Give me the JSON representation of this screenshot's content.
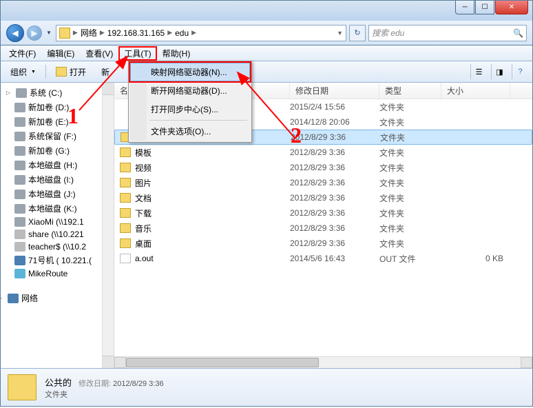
{
  "address": {
    "segs": [
      "网络",
      "192.168.31.165",
      "edu"
    ],
    "refresh_icon": "↻"
  },
  "search": {
    "placeholder": "搜索 edu",
    "icon": "🔍"
  },
  "menubar": [
    "文件(F)",
    "编辑(E)",
    "查看(V)",
    "工具(T)",
    "帮助(H)"
  ],
  "toolbar": {
    "organize": "组织",
    "open": "打开",
    "new": "新"
  },
  "dropdown": {
    "items": [
      "映射网络驱动器(N)...",
      "断开网络驱动器(D)...",
      "打开同步中心(S)...",
      "文件夹选项(O)..."
    ]
  },
  "tree": {
    "items": [
      {
        "label": "系统 (C:)",
        "exp": true
      },
      {
        "label": "新加卷 (D:)"
      },
      {
        "label": "新加卷 (E:)"
      },
      {
        "label": "系统保留 (F:)"
      },
      {
        "label": "新加卷 (G:)"
      },
      {
        "label": "本地磁盘 (H:)"
      },
      {
        "label": "本地磁盘 (I:)"
      },
      {
        "label": "本地磁盘 (J:)"
      },
      {
        "label": "本地磁盘 (K:)"
      },
      {
        "label": "XiaoMi (\\\\192.1"
      },
      {
        "label": "share (\\\\10.221",
        "disabled": true
      },
      {
        "label": "teacher$ (\\\\10.2",
        "disabled": true
      },
      {
        "label": "71号机 ( 10.221.(",
        "icon": "net"
      },
      {
        "label": "MikeRoute",
        "icon": "route"
      }
    ],
    "root": "网络"
  },
  "columns": {
    "name": "名称",
    "date": "修改日期",
    "type": "类型",
    "size": "大小"
  },
  "files": [
    {
      "name": "",
      "date": "2015/2/4 15:56",
      "type": "文件夹",
      "hidden": true
    },
    {
      "name": "",
      "date": "2014/12/8 20:06",
      "type": "文件夹",
      "hidden": true
    },
    {
      "name": "公共的",
      "date": "2012/8/29 3:36",
      "type": "文件夹",
      "sel": true
    },
    {
      "name": "模板",
      "date": "2012/8/29 3:36",
      "type": "文件夹"
    },
    {
      "name": "视频",
      "date": "2012/8/29 3:36",
      "type": "文件夹"
    },
    {
      "name": "图片",
      "date": "2012/8/29 3:36",
      "type": "文件夹"
    },
    {
      "name": "文档",
      "date": "2012/8/29 3:36",
      "type": "文件夹"
    },
    {
      "name": "下载",
      "date": "2012/8/29 3:36",
      "type": "文件夹"
    },
    {
      "name": "音乐",
      "date": "2012/8/29 3:36",
      "type": "文件夹"
    },
    {
      "name": "桌面",
      "date": "2012/8/29 3:36",
      "type": "文件夹"
    },
    {
      "name": "a.out",
      "date": "2014/5/6 16:43",
      "type": "OUT 文件",
      "size": "0 KB",
      "file": true
    }
  ],
  "details": {
    "name": "公共的",
    "date_label": "修改日期:",
    "date": "2012/8/29 3:36",
    "type": "文件夹"
  },
  "anno": {
    "n1": "1",
    "n2": "2"
  }
}
